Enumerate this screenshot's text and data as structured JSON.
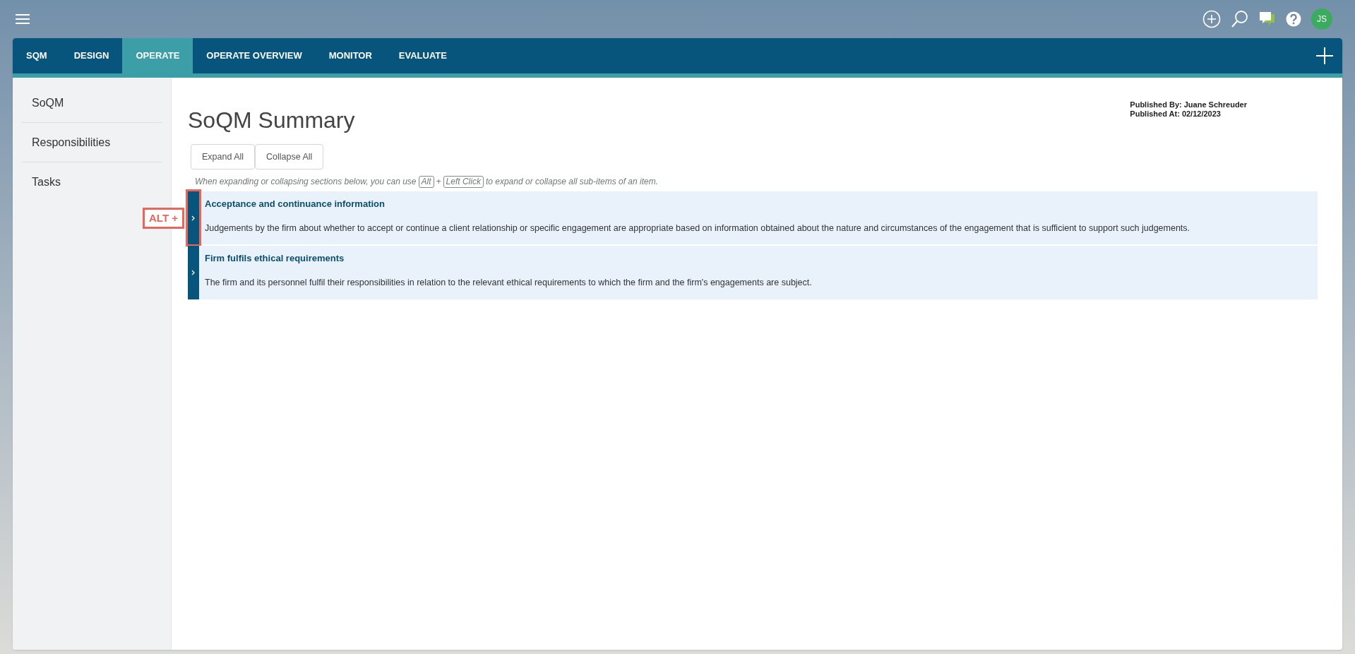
{
  "top_bar": {
    "avatar_initials": "JS"
  },
  "tabs": [
    {
      "label": "SQM",
      "selected": false
    },
    {
      "label": "DESIGN",
      "selected": false
    },
    {
      "label": "OPERATE",
      "selected": true
    },
    {
      "label": "OPERATE OVERVIEW",
      "selected": false
    },
    {
      "label": "MONITOR",
      "selected": false
    },
    {
      "label": "EVALUATE",
      "selected": false
    }
  ],
  "sidebar": {
    "items": [
      {
        "label": "SoQM"
      },
      {
        "label": "Responsibilities"
      },
      {
        "label": "Tasks"
      }
    ]
  },
  "page": {
    "title": "SoQM Summary",
    "published_by": "Published By: Juane Schreuder",
    "published_at": "Published At: 02/12/2023",
    "buttons": [
      "Expand All",
      "Collapse All"
    ],
    "hint": {
      "before": "When expanding or collapsing sections below, you can use",
      "key_1": "Alt",
      "plus": "+",
      "key_2": "Left Click",
      "after": "to expand or collapse all sub-items of an item."
    },
    "items": [
      {
        "title": "Acceptance and continuance information",
        "description": "Judgements by the firm about whether to accept or continue a client relationship or specific engagement are appropriate based on information obtained about the nature and circumstances of the engagement that is sufficient to support such judgements.",
        "expanded": false,
        "highlighted": true
      },
      {
        "title": "Firm fulfils ethical requirements",
        "description": "The firm and its personnel fulfil their responsibilities in relation to the relevant ethical requirements to which the firm and the firm's engagements are subject.",
        "expanded": false,
        "highlighted": false
      }
    ],
    "annotation": {
      "text": "ALT +"
    }
  }
}
